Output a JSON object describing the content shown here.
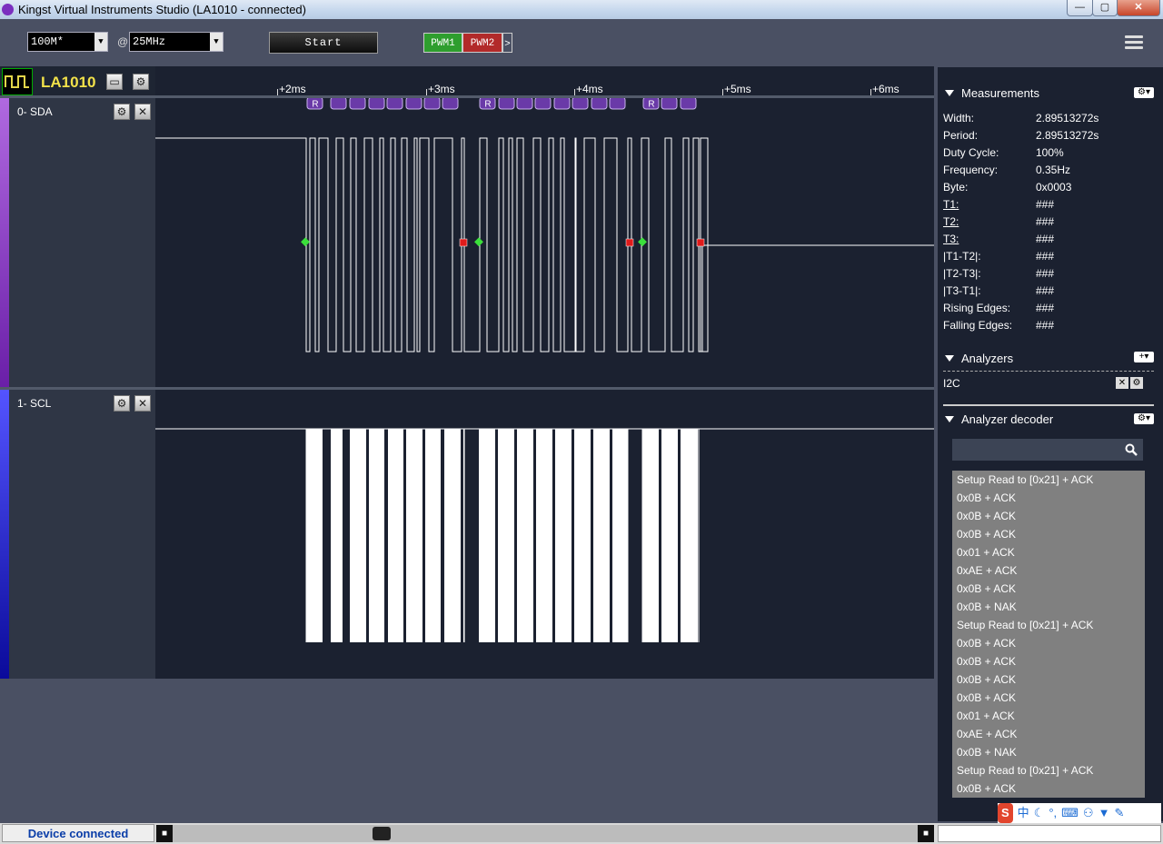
{
  "window": {
    "title": "Kingst Virtual Instruments Studio (LA1010 - connected)",
    "buttons": [
      "—",
      "▢",
      "✕"
    ]
  },
  "toolbar": {
    "sample_depth": "100M*",
    "at_symbol": "@",
    "sample_rate": "25MHz",
    "start_label": "Start",
    "pwm1_label": "PWM1",
    "pwm2_label": "PWM2",
    "pwm_more": ">",
    "colors": {
      "pwm1": "#2e9e2e",
      "pwm2": "#b22a2a"
    }
  },
  "device": {
    "name": "LA1010"
  },
  "channels": [
    {
      "label": "0-  SDA",
      "color": "#a24bd6"
    },
    {
      "label": "1-  SCL",
      "color": "#2222ee"
    }
  ],
  "ruler": {
    "ticks": [
      "+2ms",
      "+3ms",
      "+4ms",
      "+5ms",
      "+6ms"
    ]
  },
  "markers": {
    "read_label": "R"
  },
  "measurements": {
    "title": "Measurements",
    "rows": [
      {
        "label": "Width:",
        "value": "2.89513272s"
      },
      {
        "label": "Period:",
        "value": "2.89513272s"
      },
      {
        "label": "Duty Cycle:",
        "value": "100%"
      },
      {
        "label": "Frequency:",
        "value": "0.35Hz"
      },
      {
        "label": "Byte:",
        "value": "0x0003"
      },
      {
        "label": "T1:",
        "value": "###"
      },
      {
        "label": "T2:",
        "value": "###"
      },
      {
        "label": "T3:",
        "value": "###"
      },
      {
        "label": "|T1-T2|:",
        "value": "###"
      },
      {
        "label": "|T2-T3|:",
        "value": "###"
      },
      {
        "label": "|T3-T1|:",
        "value": "###"
      },
      {
        "label": "Rising Edges:",
        "value": "###"
      },
      {
        "label": "Falling Edges:",
        "value": "###"
      }
    ]
  },
  "analyzers": {
    "title": "Analyzers",
    "items": [
      "I2C"
    ]
  },
  "decoder": {
    "title": "Analyzer decoder",
    "search_placeholder": "",
    "items": [
      "Setup Read to [0x21] + ACK",
      "0x0B + ACK",
      "0x0B + ACK",
      "0x0B + ACK",
      "0x01 + ACK",
      "0xAE + ACK",
      "0x0B + ACK",
      "0x0B + NAK",
      "Setup Read to [0x21] + ACK",
      "0x0B + ACK",
      "0x0B + ACK",
      "0x0B + ACK",
      "0x0B + ACK",
      "0x01 + ACK",
      "0xAE + ACK",
      "0x0B + NAK",
      "Setup Read to [0x21] + ACK",
      "0x0B + ACK"
    ]
  },
  "status": {
    "text": "Device connected"
  },
  "ime": {
    "logo": "S",
    "mode": "中"
  }
}
